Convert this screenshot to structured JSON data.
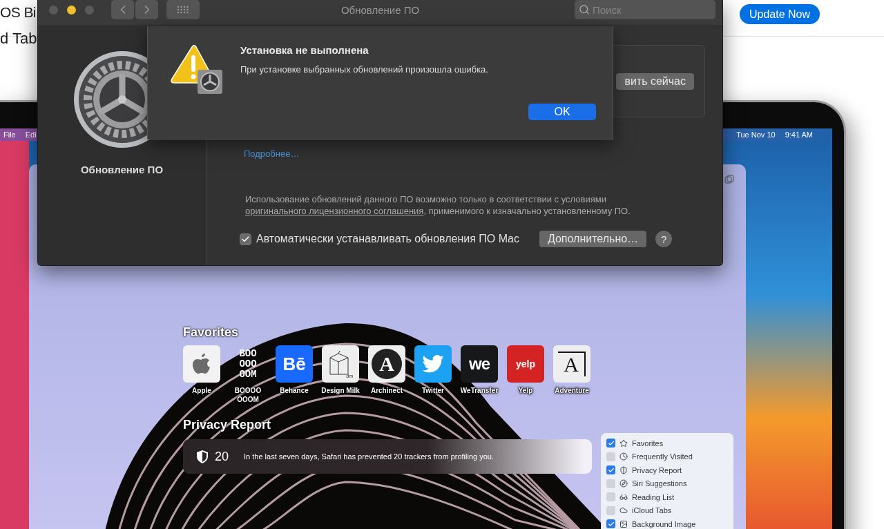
{
  "background_page": {
    "title": "OS Bi",
    "subtitle": "d Tab",
    "update_button": "Update Now"
  },
  "laptop_screen": {
    "menu_bar": {
      "menus": [
        "File",
        "Edi"
      ],
      "date": "Tue Nov 10",
      "time": "9:41 AM"
    },
    "safari": {
      "favorites_title": "Favorites",
      "favorites": [
        {
          "label": "Apple",
          "kind": "apple"
        },
        {
          "label": "BOOOO OOOM",
          "kind": "booooom",
          "logo": "BOO OOO OOM"
        },
        {
          "label": "Behance",
          "kind": "behance",
          "logo": "Bē"
        },
        {
          "label": "Design Milk",
          "kind": "designmilk",
          "logo": "dm"
        },
        {
          "label": "Archinect",
          "kind": "archinect",
          "logo": "A"
        },
        {
          "label": "Twitter",
          "kind": "twitter"
        },
        {
          "label": "WeTransfer",
          "kind": "wetransfer",
          "logo": "we"
        },
        {
          "label": "Yelp",
          "kind": "yelp",
          "logo": "yelp"
        },
        {
          "label": "Adventure",
          "kind": "adventure",
          "logo": "A"
        }
      ],
      "privacy_title": "Privacy Report",
      "privacy_count": "20",
      "privacy_text": "In the last seven days, Safari has prevented 20 trackers from profiling you.",
      "customize": [
        {
          "label": "Favorites",
          "kind": "star",
          "checked": true
        },
        {
          "label": "Frequently Visited",
          "kind": "clock",
          "checked": false
        },
        {
          "label": "Privacy Report",
          "kind": "shield",
          "checked": true
        },
        {
          "label": "Siri Suggestions",
          "kind": "compass",
          "checked": false
        },
        {
          "label": "Reading List",
          "kind": "glasses",
          "checked": false
        },
        {
          "label": "iCloud Tabs",
          "kind": "cloud",
          "checked": false
        },
        {
          "label": "Background Image",
          "kind": "image",
          "checked": true
        }
      ]
    }
  },
  "preferences_window": {
    "title": "Обновление ПО",
    "search": {
      "placeholder": "Поиск"
    },
    "sidebar_label": "Обновление ПО",
    "update_button": "вить сейчас",
    "more_link": "Подробнее…",
    "license_text": "Использование обновлений данного ПО возможно только в соответствии с условиями",
    "license_link": "оригинального лицензионного соглашения",
    "license_tail": ", применимого к изначально установленному ПО.",
    "auto_update": {
      "label": "Автоматически устанавливать обновления ПО Mac",
      "checked": true
    },
    "advanced_button": "Дополнительно…",
    "help_button": "?"
  },
  "alert": {
    "title": "Установка не выполнена",
    "message": "При установке выбранных обновлений произошла ошибка.",
    "button": "OK"
  }
}
